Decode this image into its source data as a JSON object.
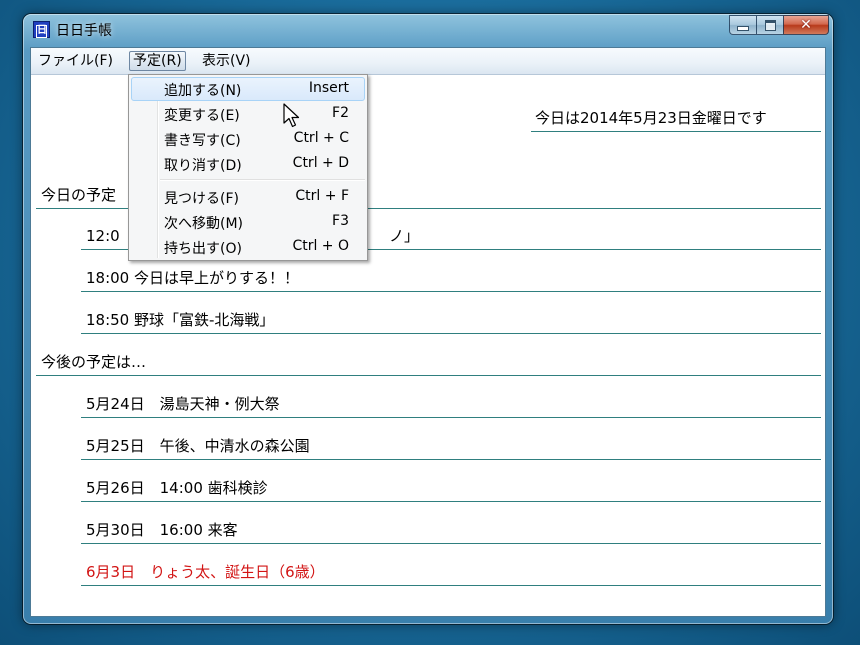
{
  "window": {
    "title": "日日手帳",
    "app_icon_letter": "日"
  },
  "menubar": {
    "items": [
      {
        "label": "ファイル(F)"
      },
      {
        "label": "予定(R)"
      },
      {
        "label": "表示(V)"
      }
    ]
  },
  "dropdown": {
    "items": [
      {
        "label": "追加する(N)",
        "shortcut": "Insert"
      },
      {
        "label": "変更する(E)",
        "shortcut": "F2"
      },
      {
        "label": "書き写す(C)",
        "shortcut": "Ctrl + C"
      },
      {
        "label": "取り消す(D)",
        "shortcut": "Ctrl + D"
      },
      {
        "label": "見つける(F)",
        "shortcut": "Ctrl + F"
      },
      {
        "label": "次へ移動(M)",
        "shortcut": "F3"
      },
      {
        "label": "持ち出す(O)",
        "shortcut": "Ctrl + O"
      }
    ]
  },
  "content": {
    "today_header": "今日は2014年5月23日金曜日です",
    "today_section": "今日の予定",
    "today_items": [
      {
        "text": "12:0"
      },
      {
        "text": "18:00 今日は早上がりする！！"
      },
      {
        "text": "18:50 野球「富鉄-北海戦」"
      }
    ],
    "today_item0_tail": "ノ」",
    "future_section": "今後の予定は…",
    "future_items": [
      {
        "text": "5月24日　湯島天神・例大祭"
      },
      {
        "text": "5月25日　午後、中清水の森公園"
      },
      {
        "text": "5月26日　14:00 歯科検診"
      },
      {
        "text": "5月30日　16:00 来客"
      },
      {
        "text": "6月3日　りょう太、誕生日（6歳）"
      }
    ],
    "highlight_color": "#d21414"
  }
}
